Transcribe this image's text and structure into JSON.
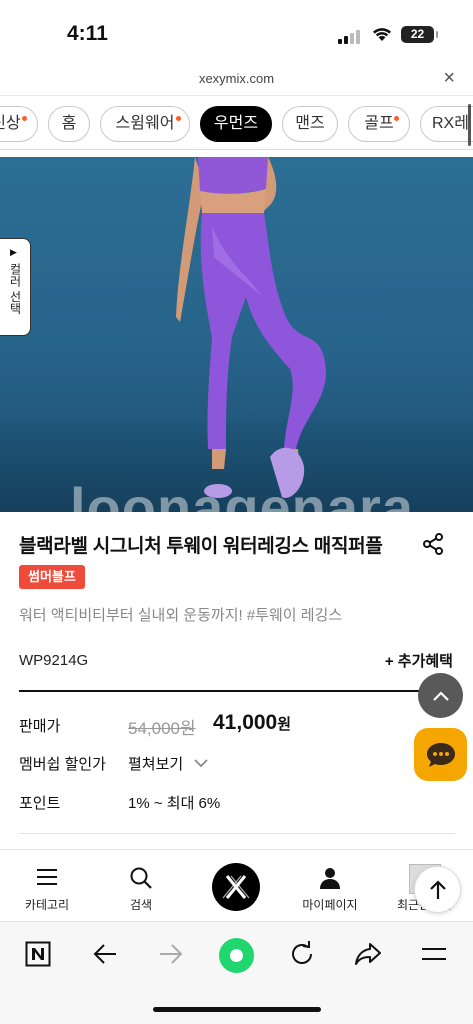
{
  "status": {
    "time": "4:11",
    "battery": "22"
  },
  "browser": {
    "url": "xexymix.com"
  },
  "categories": [
    {
      "label": "신상",
      "dot": true,
      "active": false
    },
    {
      "label": "홈",
      "dot": false,
      "active": false
    },
    {
      "label": "스윔웨어",
      "dot": true,
      "active": false
    },
    {
      "label": "우먼즈",
      "dot": false,
      "active": true
    },
    {
      "label": "맨즈",
      "dot": false,
      "active": false
    },
    {
      "label": "골프",
      "dot": true,
      "active": false
    },
    {
      "label": "RX레",
      "dot": false,
      "active": false
    }
  ],
  "hero": {
    "watermark": "loonagenara",
    "color_select_label": "컬러 선택"
  },
  "product": {
    "title": "블랙라벨 시그니처 투웨이 워터레깅스 매직퍼플",
    "badge": "썸머블프",
    "description": "워터 액티비티부터 실내외 운동까지! #투웨이 레깅스",
    "sku": "WP9214G",
    "benefit_label": "+ 추가혜택",
    "price_label": "판매가",
    "original_price": "54,000원",
    "sale_price": "41,000",
    "currency": "원",
    "member_discount_label": "멤버쉽 할인가",
    "member_discount_value": "펼쳐보기",
    "points_label": "포인트",
    "points_value": "1% ~ 최대 6%"
  },
  "bottom_nav": {
    "category": "카테고리",
    "search": "검색",
    "mypage": "마이페이지",
    "recent": "최근본상품"
  },
  "colors": {
    "accent": "#ef4b3a",
    "chat": "#f6a600",
    "toggle_green": "#1fd76e",
    "purple": "#8c55d8"
  }
}
